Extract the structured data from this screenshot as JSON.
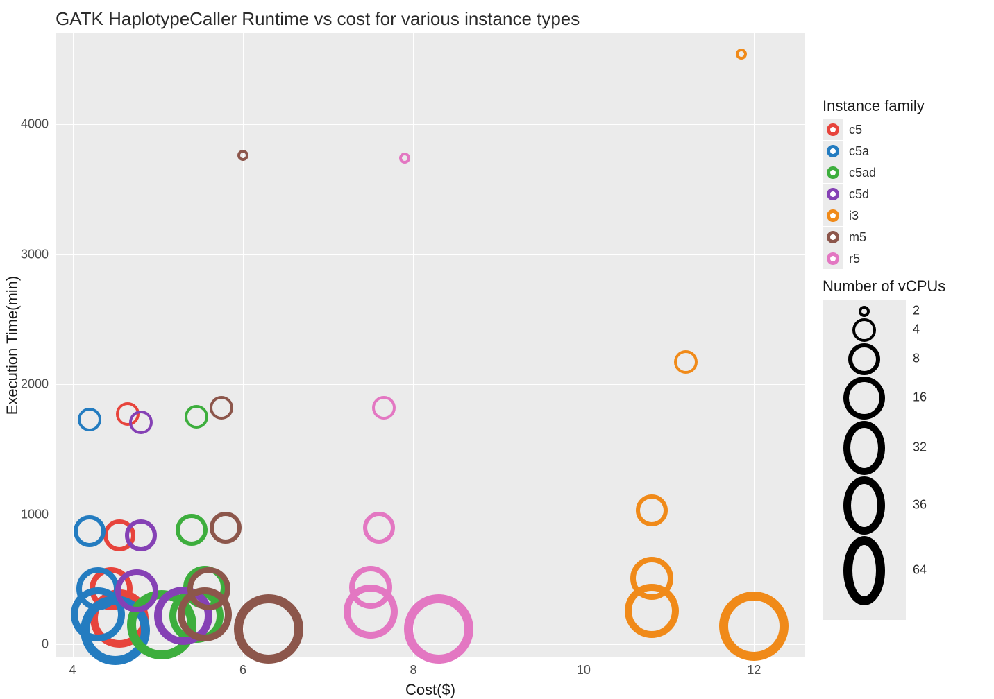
{
  "chart_data": {
    "type": "scatter",
    "title": "GATK HaplotypeCaller Runtime vs cost for various instance types",
    "xlabel": "Cost($)",
    "ylabel": "Execution Time(min)",
    "xlim": [
      3.8,
      12.6
    ],
    "ylim": [
      -100,
      4700
    ],
    "x_ticks": [
      4,
      6,
      8,
      10,
      12
    ],
    "y_ticks": [
      0,
      1000,
      2000,
      3000,
      4000
    ],
    "legend_color_title": "Instance family",
    "legend_size_title": "Number of vCPUs",
    "color_map": {
      "c5": "#F8766D",
      "c5a": "#C49A00",
      "c5ad": "#53B400",
      "c5d": "#00C094",
      "i3": "#00B6EB",
      "m5": "#A58AFF",
      "r5": "#FB61D7"
    },
    "families_ordered": [
      "c5",
      "c5a",
      "c5ad",
      "c5d",
      "i3",
      "m5",
      "r5"
    ],
    "family_colors_display": {
      "c5": "#E7443C",
      "c5a": "#247CC0",
      "c5ad": "#3DAE3D",
      "c5d": "#8541B5",
      "i3": "#F08A19",
      "m5": "#8C564B",
      "r5": "#E377C2"
    },
    "size_legend": [
      2,
      4,
      8,
      16,
      32,
      36,
      64
    ],
    "series": [
      {
        "family": "c5",
        "vcpus": 4,
        "x": 4.65,
        "y": 1770
      },
      {
        "family": "c5",
        "vcpus": 8,
        "x": 4.55,
        "y": 840
      },
      {
        "family": "c5",
        "vcpus": 16,
        "x": 4.45,
        "y": 430
      },
      {
        "family": "c5",
        "vcpus": 36,
        "x": 4.55,
        "y": 200
      },
      {
        "family": "c5a",
        "vcpus": 4,
        "x": 4.2,
        "y": 1730
      },
      {
        "family": "c5a",
        "vcpus": 8,
        "x": 4.2,
        "y": 870
      },
      {
        "family": "c5a",
        "vcpus": 16,
        "x": 4.3,
        "y": 430
      },
      {
        "family": "c5a",
        "vcpus": 32,
        "x": 4.3,
        "y": 230
      },
      {
        "family": "c5a",
        "vcpus": 64,
        "x": 4.5,
        "y": 110
      },
      {
        "family": "c5ad",
        "vcpus": 4,
        "x": 5.45,
        "y": 1750
      },
      {
        "family": "c5ad",
        "vcpus": 8,
        "x": 5.4,
        "y": 880
      },
      {
        "family": "c5ad",
        "vcpus": 16,
        "x": 5.55,
        "y": 440
      },
      {
        "family": "c5ad",
        "vcpus": 32,
        "x": 5.45,
        "y": 220
      },
      {
        "family": "c5ad",
        "vcpus": 64,
        "x": 5.05,
        "y": 150
      },
      {
        "family": "c5d",
        "vcpus": 4,
        "x": 4.8,
        "y": 1710
      },
      {
        "family": "c5d",
        "vcpus": 8,
        "x": 4.8,
        "y": 840
      },
      {
        "family": "c5d",
        "vcpus": 16,
        "x": 4.75,
        "y": 410
      },
      {
        "family": "c5d",
        "vcpus": 36,
        "x": 5.3,
        "y": 220
      },
      {
        "family": "i3",
        "vcpus": 2,
        "x": 11.85,
        "y": 4540
      },
      {
        "family": "i3",
        "vcpus": 4,
        "x": 11.2,
        "y": 2170
      },
      {
        "family": "i3",
        "vcpus": 8,
        "x": 10.8,
        "y": 1030
      },
      {
        "family": "i3",
        "vcpus": 16,
        "x": 10.8,
        "y": 510
      },
      {
        "family": "i3",
        "vcpus": 32,
        "x": 10.8,
        "y": 260
      },
      {
        "family": "i3",
        "vcpus": 64,
        "x": 12.0,
        "y": 140
      },
      {
        "family": "m5",
        "vcpus": 2,
        "x": 6.0,
        "y": 3760
      },
      {
        "family": "m5",
        "vcpus": 4,
        "x": 5.75,
        "y": 1820
      },
      {
        "family": "m5",
        "vcpus": 8,
        "x": 5.8,
        "y": 900
      },
      {
        "family": "m5",
        "vcpus": 16,
        "x": 5.6,
        "y": 430
      },
      {
        "family": "m5",
        "vcpus": 32,
        "x": 5.55,
        "y": 230
      },
      {
        "family": "m5",
        "vcpus": 64,
        "x": 6.3,
        "y": 120
      },
      {
        "family": "r5",
        "vcpus": 2,
        "x": 7.9,
        "y": 3740
      },
      {
        "family": "r5",
        "vcpus": 4,
        "x": 7.65,
        "y": 1820
      },
      {
        "family": "r5",
        "vcpus": 8,
        "x": 7.6,
        "y": 900
      },
      {
        "family": "r5",
        "vcpus": 16,
        "x": 7.5,
        "y": 440
      },
      {
        "family": "r5",
        "vcpus": 32,
        "x": 7.5,
        "y": 250
      },
      {
        "family": "r5",
        "vcpus": 64,
        "x": 8.3,
        "y": 120
      }
    ]
  }
}
